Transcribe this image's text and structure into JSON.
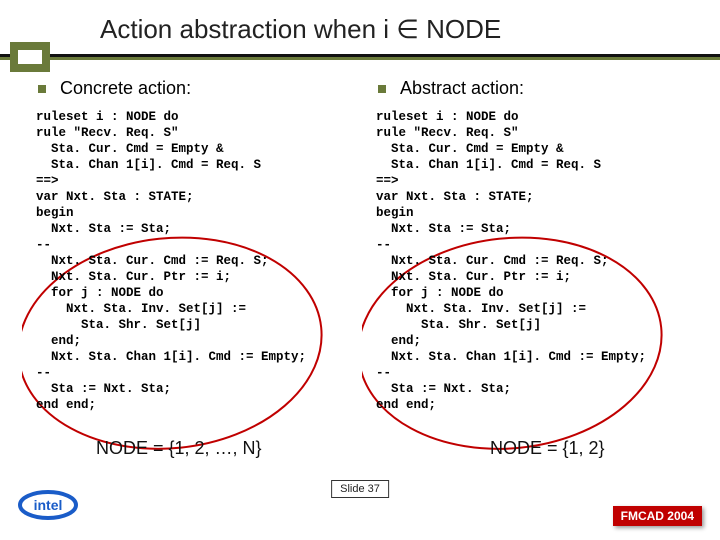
{
  "title": "Action abstraction when i ∈ NODE",
  "left": {
    "heading": "Concrete action:",
    "code": "ruleset i : NODE do\nrule \"Recv. Req. S\"\n  Sta. Cur. Cmd = Empty &\n  Sta. Chan 1[i]. Cmd = Req. S\n==>\nvar Nxt. Sta : STATE;\nbegin\n  Nxt. Sta := Sta;\n--\n  Nxt. Sta. Cur. Cmd := Req. S;\n  Nxt. Sta. Cur. Ptr := i;\n  for j : NODE do\n    Nxt. Sta. Inv. Set[j] :=\n      Sta. Shr. Set[j]\n  end;\n  Nxt. Sta. Chan 1[i]. Cmd := Empty;\n--\n  Sta := Nxt. Sta;\nend end;",
    "note": "NODE = {1, 2, …, N}"
  },
  "right": {
    "heading": "Abstract action:",
    "code": "ruleset i : NODE do\nrule \"Recv. Req. S\"\n  Sta. Cur. Cmd = Empty &\n  Sta. Chan 1[i]. Cmd = Req. S\n==>\nvar Nxt. Sta : STATE;\nbegin\n  Nxt. Sta := Sta;\n--\n  Nxt. Sta. Cur. Cmd := Req. S;\n  Nxt. Sta. Cur. Ptr := i;\n  for j : NODE do\n    Nxt. Sta. Inv. Set[j] :=\n      Sta. Shr. Set[j]\n  end;\n  Nxt. Sta. Chan 1[i]. Cmd := Empty;\n--\n  Sta := Nxt. Sta;\nend end;",
    "note": "NODE = {1, 2}"
  },
  "slide": "Slide 37",
  "footer": "FMCAD 2004"
}
